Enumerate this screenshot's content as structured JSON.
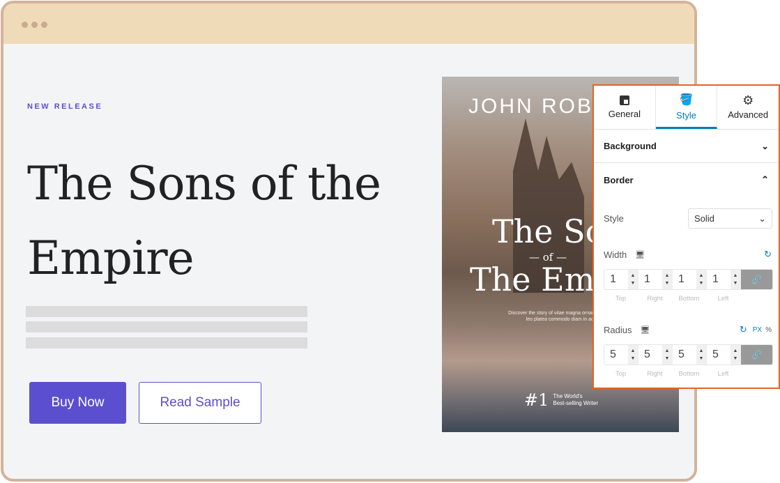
{
  "hero": {
    "eyebrow": "NEW RELEASE",
    "title": "The Sons of the Empire",
    "buy": "Buy Now",
    "read": "Read Sample",
    "accent": "#5b4fcf"
  },
  "cover": {
    "author": "JOHN ROB",
    "title1": "The So",
    "of": "— of —",
    "title2": "The Em",
    "desc1": "Discover the story of vitae magna ornare commodo lec",
    "desc2": "leo platea commodo diam in ac urna n",
    "rank": "#1",
    "rank_text1": "The World's",
    "rank_text2": "Best-selling Writer"
  },
  "panel": {
    "tabs": [
      {
        "label": "General",
        "icon": "layout-icon"
      },
      {
        "label": "Style",
        "icon": "paint-bucket-icon",
        "active": true
      },
      {
        "label": "Advanced",
        "icon": "gear-icon"
      }
    ],
    "background": "Background",
    "border": "Border",
    "style_label": "Style",
    "style_value": "Solid",
    "width_label": "Width",
    "width_values": [
      "1",
      "1",
      "1",
      "1"
    ],
    "radius_label": "Radius",
    "radius_values": [
      "5",
      "5",
      "5",
      "5"
    ],
    "unit_px": "PX",
    "unit_pct": "%",
    "sides": [
      "Top",
      "Right",
      "Bottom",
      "Left"
    ],
    "highlight": "#e8631c",
    "accent": "#007cba"
  }
}
